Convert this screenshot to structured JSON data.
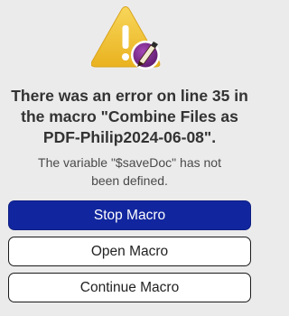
{
  "dialog": {
    "icon": "warning-triangle-with-app-badge-icon",
    "title_lines": [
      "There was an error on line 35 in",
      "the macro \"Combine Files as",
      "PDF-Philip2024-06-08\"."
    ],
    "message_lines": [
      "The variable \"$saveDoc\" has not",
      "been defined."
    ],
    "buttons": {
      "stop": "Stop Macro",
      "open": "Open Macro",
      "continue": "Continue Macro"
    }
  },
  "colors": {
    "background": "#ecebec",
    "primary_button": "#11269e",
    "warning_yellow": "#f3c230",
    "badge_purple": "#7a2a8a"
  }
}
